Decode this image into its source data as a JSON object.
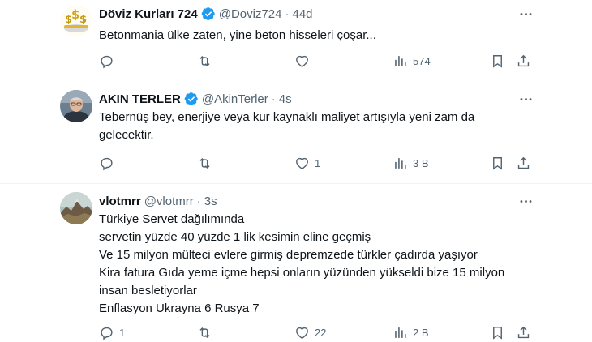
{
  "tweets": [
    {
      "name": "Döviz Kurları 724",
      "handle": "@Doviz724",
      "separator": "·",
      "time": "44d",
      "lines": [
        "Betonmania ülke zaten, yine beton hisseleri çoşar..."
      ],
      "reply_count": "",
      "retweet_count": "",
      "like_count": "",
      "view_count": "574"
    },
    {
      "name": "AKIN TERLER",
      "handle": "@AkinTerler",
      "separator": "·",
      "time": "4s",
      "lines": [
        "Tebernüş bey, enerjiye veya kur kaynaklı maliyet artışıyla  yeni zam da",
        "gelecektir."
      ],
      "reply_count": "",
      "retweet_count": "",
      "like_count": "1",
      "view_count": "3 B"
    },
    {
      "name": "vlotmrr",
      "handle": "@vlotmrr",
      "separator": "·",
      "time": "3s",
      "lines": [
        "Türkiye Servet dağılımında",
        "servetin yüzde 40 yüzde 1 lik kesimin eline geçmiş",
        "Ve 15 milyon mülteci evlere girmiş depremzede türkler çadırda yaşıyor",
        "Kira fatura Gıda yeme içme  hepsi onların yüzünden yükseldi bize 15 milyon",
        "insan besletiyorlar",
        "Enflasyon Ukrayna 6 Rusya 7"
      ],
      "reply_count": "1",
      "retweet_count": "",
      "like_count": "22",
      "view_count": "2 B"
    }
  ],
  "icons": {
    "more": "more-icon",
    "reply": "reply-icon",
    "retweet": "retweet-icon",
    "like": "like-icon",
    "views": "views-icon",
    "bookmark": "bookmark-icon",
    "share": "share-icon",
    "verified": "verified-badge-icon"
  },
  "colors": {
    "text": "#0f1419",
    "muted": "#536471",
    "verified": "#1d9bf0",
    "divider": "#eff3f4"
  }
}
